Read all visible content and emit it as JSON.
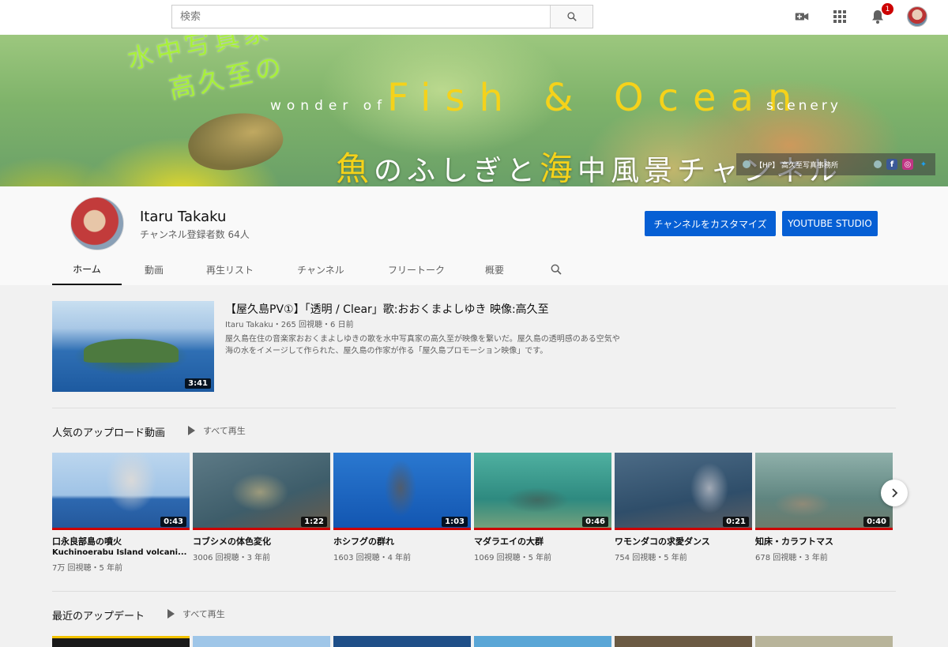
{
  "search": {
    "placeholder": "検索"
  },
  "topbar": {
    "notification_count": "1"
  },
  "banner": {
    "jp_line1": "水中写真家",
    "jp_line2": "高久至の",
    "wonder_of": "wonder of",
    "fish_ocean": "Fish & Ocean",
    "scenery": "scenery",
    "jp_fish": "魚",
    "jp_nofushigito": "のふしぎと",
    "jp_umi": "海",
    "jp_channel": "中風景チャンネル",
    "links_label": "【HP】 高久至写真事務所"
  },
  "channel": {
    "name": "Itaru Takaku",
    "subscribers": "チャンネル登録者数 64人",
    "customize_label": "チャンネルをカスタマイズ",
    "studio_label": "YOUTUBE STUDIO",
    "tabs": [
      "ホーム",
      "動画",
      "再生リスト",
      "チャンネル",
      "フリートーク",
      "概要"
    ]
  },
  "featured": {
    "title": "【屋久島PV①】「透明 / Clear」歌:おおくまよしゆき 映像:高久至",
    "meta": "Itaru Takaku・265 回視聴・6 日前",
    "desc": "屋久島在住の音楽家おおくまよしゆきの歌を水中写真家の高久至が映像を繋いだ。屋久島の透明感のある空気や海の水をイメージして作られた、屋久島の作家が作る「屋久島プロモーション映像」です。",
    "duration": "3:41"
  },
  "popular": {
    "title": "人気のアップロード動画",
    "play_all": "すべて再生",
    "videos": [
      {
        "title": "口永良部島の噴火",
        "title2": "Kuchinoerabu Island volcani...",
        "meta": "7万 回視聴・5 年前",
        "duration": "0:43"
      },
      {
        "title": "コブシメの体色変化",
        "title2": "",
        "meta": "3006 回視聴・3 年前",
        "duration": "1:22"
      },
      {
        "title": "ホシフグの群れ",
        "title2": "",
        "meta": "1603 回視聴・4 年前",
        "duration": "1:03"
      },
      {
        "title": "マダラエイの大群",
        "title2": "",
        "meta": "1069 回視聴・5 年前",
        "duration": "0:46"
      },
      {
        "title": "ワモンダコの求愛ダンス",
        "title2": "",
        "meta": "754 回視聴・5 年前",
        "duration": "0:21"
      },
      {
        "title": "知床・カラフトマス",
        "title2": "",
        "meta": "678 回視聴・3 年前",
        "duration": "0:40"
      }
    ]
  },
  "recent": {
    "title": "最近のアップデート",
    "play_all": "すべて再生"
  },
  "colors": {
    "accent_blue": "#065fd4",
    "progress_red": "#cc0000"
  }
}
